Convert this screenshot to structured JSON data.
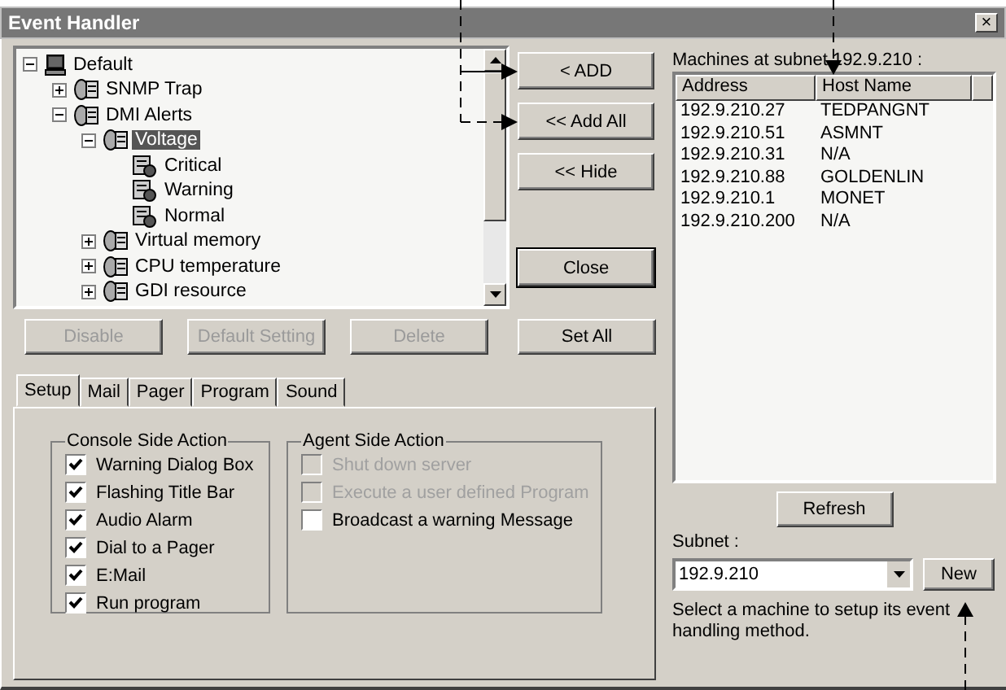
{
  "window": {
    "title": "Event Handler",
    "close": "×"
  },
  "tree": [
    {
      "label": "Default",
      "kind": "computer",
      "expanded": true,
      "selected": false,
      "children": [
        {
          "label": "SNMP Trap",
          "kind": "group",
          "expanded": false,
          "selected": false
        },
        {
          "label": "DMI Alerts",
          "kind": "group",
          "expanded": true,
          "selected": false,
          "children": [
            {
              "label": "Voltage",
              "kind": "group",
              "expanded": true,
              "selected": true,
              "children": [
                {
                  "label": "Critical",
                  "kind": "alert",
                  "selected": false
                },
                {
                  "label": "Warning",
                  "kind": "alert",
                  "selected": false
                },
                {
                  "label": "Normal",
                  "kind": "alert",
                  "selected": false
                }
              ]
            },
            {
              "label": "Virtual memory",
              "kind": "group",
              "expanded": false,
              "selected": false
            },
            {
              "label": "CPU temperature",
              "kind": "group",
              "expanded": false,
              "selected": false
            },
            {
              "label": "GDI resource",
              "kind": "group",
              "expanded": false,
              "selected": false
            }
          ]
        }
      ]
    }
  ],
  "side_buttons": [
    {
      "label": "< ADD",
      "kind": "normal"
    },
    {
      "label": "<< Add All",
      "kind": "normal"
    },
    {
      "label": "<< Hide",
      "kind": "normal"
    },
    {
      "label": "Close",
      "kind": "default"
    }
  ],
  "tree_buttons": [
    {
      "label": "Disable",
      "disabled": true
    },
    {
      "label": "Default Setting",
      "disabled": true
    },
    {
      "label": "Delete",
      "disabled": true
    },
    {
      "label": "Set All",
      "disabled": false
    }
  ],
  "tabs": [
    {
      "label": "Setup",
      "selected": true
    },
    {
      "label": "Mail",
      "selected": false
    },
    {
      "label": "Pager",
      "selected": false
    },
    {
      "label": "Program",
      "selected": false
    },
    {
      "label": "Sound",
      "selected": false
    }
  ],
  "console_side": {
    "title": "Console Side Action",
    "options": [
      {
        "label": "Warning Dialog Box",
        "checked": true,
        "disabled": false
      },
      {
        "label": "Flashing Title Bar",
        "checked": true,
        "disabled": false
      },
      {
        "label": "Audio Alarm",
        "checked": true,
        "disabled": false
      },
      {
        "label": "Dial to a Pager",
        "checked": true,
        "disabled": false
      },
      {
        "label": "E:Mail",
        "checked": true,
        "disabled": false
      },
      {
        "label": "Run program",
        "checked": true,
        "disabled": false
      }
    ]
  },
  "agent_side": {
    "title": "Agent Side Action",
    "options": [
      {
        "label": "Shut down server",
        "checked": false,
        "disabled": true
      },
      {
        "label": "Execute a user defined Program",
        "checked": false,
        "disabled": true
      },
      {
        "label": "Broadcast a warning Message",
        "checked": false,
        "disabled": false
      }
    ]
  },
  "machines": {
    "label": "Machines at subnet 192.9.210 :",
    "columns": [
      "Address",
      "Host Name"
    ],
    "rows": [
      [
        "192.9.210.27",
        "TEDPANGNT"
      ],
      [
        "192.9.210.51",
        "ASMNT"
      ],
      [
        "192.9.210.31",
        "N/A"
      ],
      [
        "192.9.210.88",
        "GOLDENLIN"
      ],
      [
        "192.9.210.1",
        "MONET"
      ],
      [
        "192.9.210.200",
        "N/A"
      ]
    ]
  },
  "refresh": "Refresh",
  "subnet": {
    "label": "Subnet :",
    "value": "192.9.210",
    "new_button": "New"
  },
  "hint": "Select a machine to setup its event handling method."
}
